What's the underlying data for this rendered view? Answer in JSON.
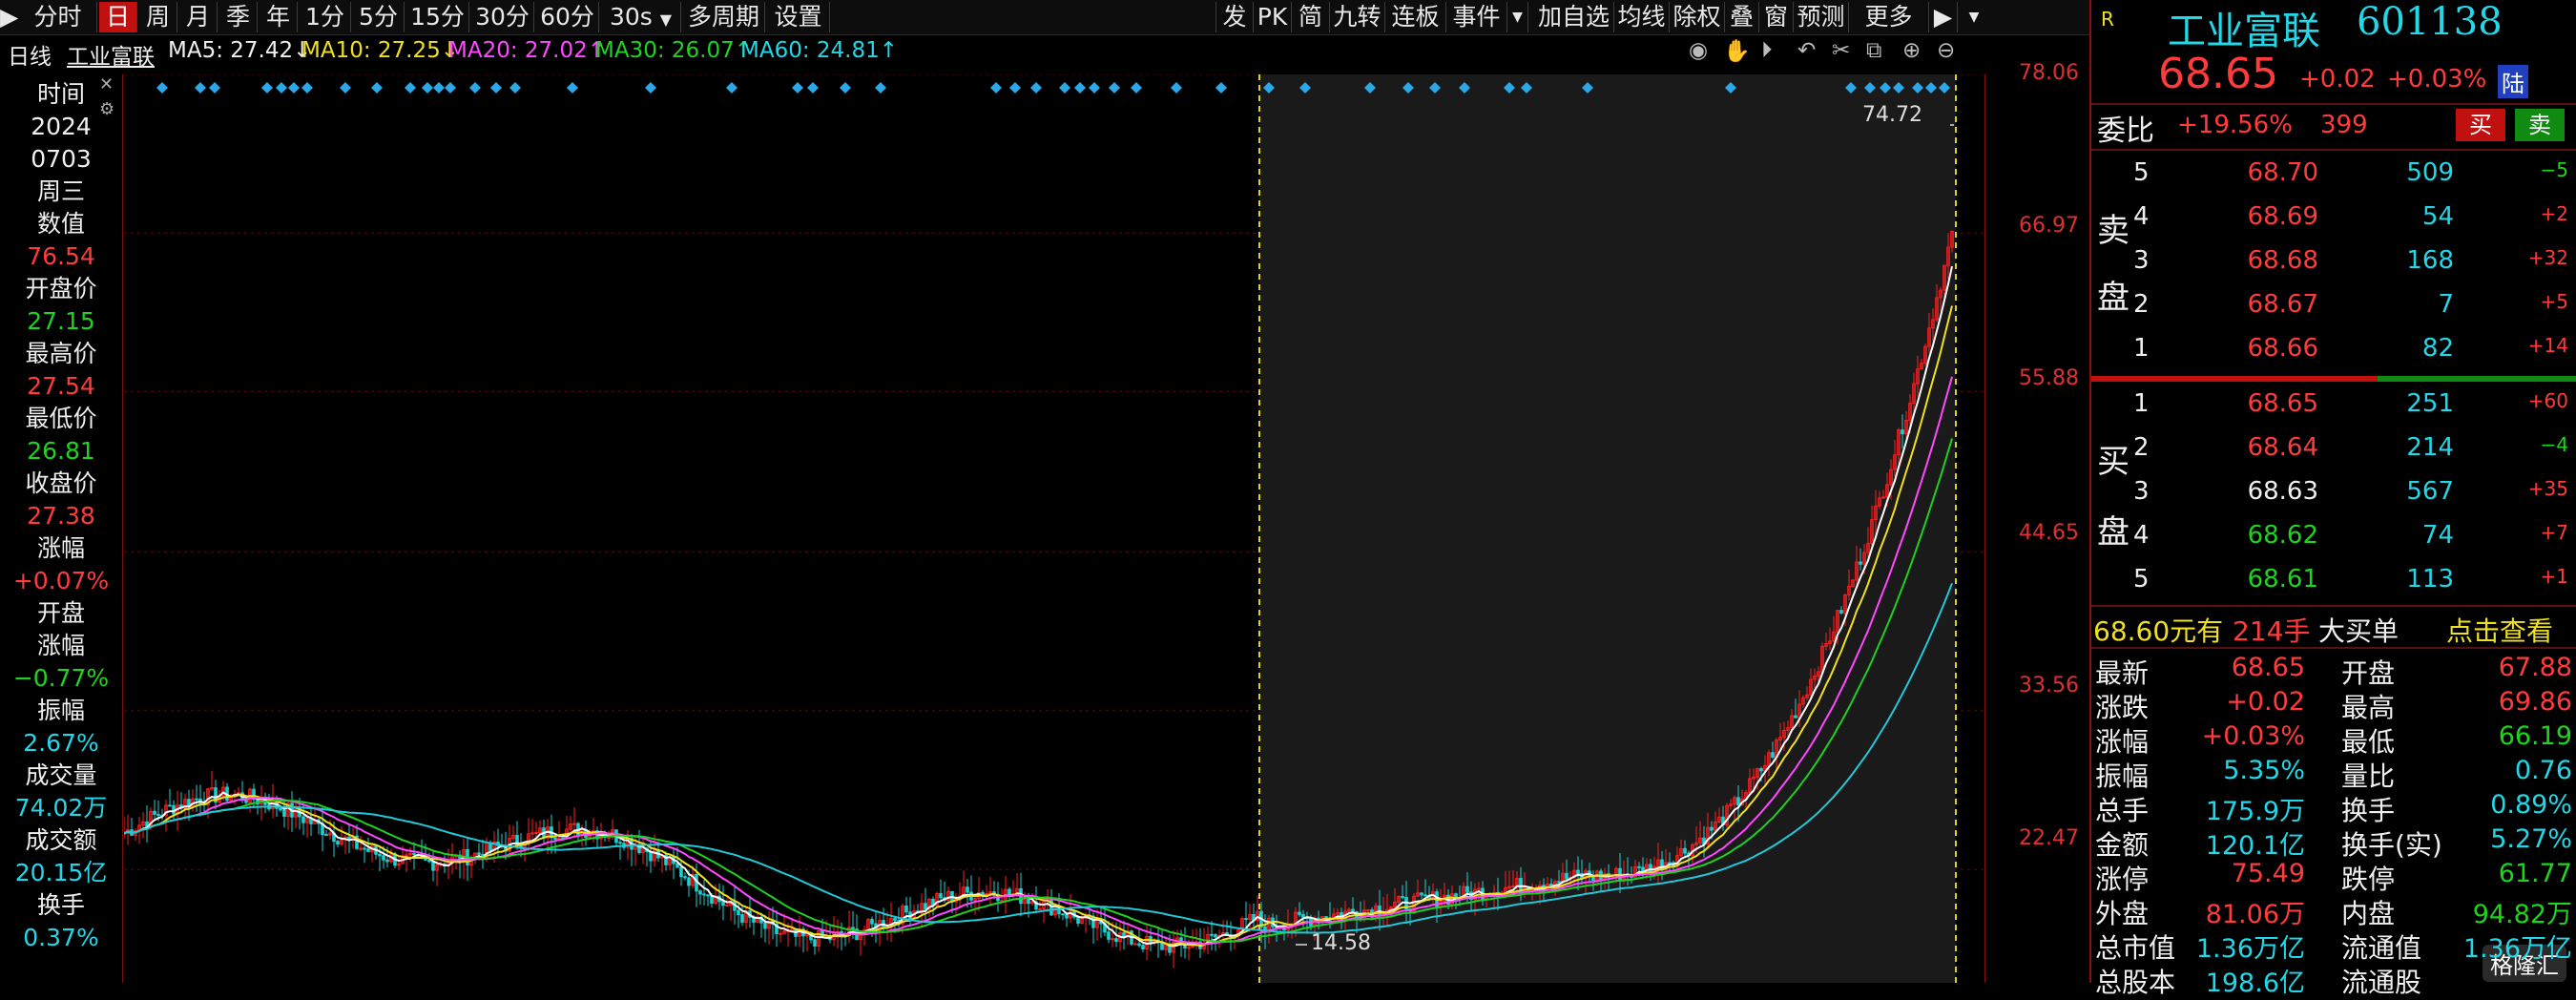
{
  "toolbar": {
    "items": [
      "分时",
      "日",
      "周",
      "月",
      "季",
      "年",
      "1分",
      "5分",
      "15分",
      "30分",
      "60分",
      "30s",
      "多周期",
      "设置"
    ],
    "right_items": [
      "发",
      "PK",
      "简",
      "九转",
      "连板",
      "事件",
      "加自选",
      "均线",
      "除权",
      "叠",
      "窗",
      "预测",
      "更多"
    ]
  },
  "indicators": {
    "period": "日线",
    "name": "工业富联",
    "ma5": "MA5: 27.42↓",
    "ma10": "MA10: 27.25↓",
    "ma20": "MA20: 27.02↑",
    "ma30": "MA30: 26.07↑",
    "ma60": "MA60: 24.81↑"
  },
  "left_info": {
    "time_label": "时间",
    "year": "2024",
    "date": "0703",
    "weekday": "周三",
    "value_label": "数值",
    "value": "76.54",
    "open_label": "开盘价",
    "open": "27.15",
    "high_label": "最高价",
    "high": "27.54",
    "low_label": "最低价",
    "low": "26.81",
    "close_label": "收盘价",
    "close": "27.38",
    "change_label": "涨幅",
    "change": "+0.07%",
    "open_change_label1": "开盘",
    "open_change_label2": "涨幅",
    "open_change": "−0.77%",
    "amplitude_label": "振幅",
    "amplitude": "2.67%",
    "volume_label": "成交量",
    "volume": "74.02万",
    "amount_label": "成交额",
    "amount": "20.15亿",
    "turnover_label": "换手",
    "turnover": "0.37%"
  },
  "axis": {
    "ticks": [
      "78.06",
      "66.97",
      "55.88",
      "44.65",
      "33.56",
      "22.47"
    ]
  },
  "chart_labels": {
    "max_label": "74.72",
    "min_label": "14.58"
  },
  "quote": {
    "r_badge": "R",
    "name": "工业富联",
    "code": "601138",
    "price": "68.65",
    "change": "+0.02",
    "change_pct": "+0.03%",
    "lu_badge": "陆",
    "weibi_label": "委比",
    "weibi": "+19.56%",
    "weicha": "399",
    "buy_btn": "买",
    "sell_btn": "卖",
    "sell_label_1": "卖",
    "sell_label_2": "盘",
    "buy_label_1": "买",
    "buy_label_2": "盘",
    "asks": [
      {
        "lvl": "5",
        "price": "68.70",
        "vol": "509",
        "chg": "−5"
      },
      {
        "lvl": "4",
        "price": "68.69",
        "vol": "54",
        "chg": "+2"
      },
      {
        "lvl": "3",
        "price": "68.68",
        "vol": "168",
        "chg": "+32"
      },
      {
        "lvl": "2",
        "price": "68.67",
        "vol": "7",
        "chg": "+5"
      },
      {
        "lvl": "1",
        "price": "68.66",
        "vol": "82",
        "chg": "+14"
      }
    ],
    "bids": [
      {
        "lvl": "1",
        "price": "68.65",
        "vol": "251",
        "chg": "+60"
      },
      {
        "lvl": "2",
        "price": "68.64",
        "vol": "214",
        "chg": "−4"
      },
      {
        "lvl": "3",
        "price": "68.63",
        "vol": "567",
        "chg": "+35"
      },
      {
        "lvl": "4",
        "price": "68.62",
        "vol": "74",
        "chg": "+7"
      },
      {
        "lvl": "5",
        "price": "68.61",
        "vol": "113",
        "chg": "+1"
      }
    ],
    "bigbuy_price": "68.60元有",
    "bigbuy_vol": "214手",
    "bigbuy_label": "大买单",
    "bigbuy_link": "点击查看",
    "stats_left": [
      {
        "k": "最新",
        "v": "68.65"
      },
      {
        "k": "涨跌",
        "v": "+0.02"
      },
      {
        "k": "涨幅",
        "v": "+0.03%"
      },
      {
        "k": "振幅",
        "v": "5.35%"
      },
      {
        "k": "总手",
        "v": "175.9万"
      },
      {
        "k": "金额",
        "v": "120.1亿"
      },
      {
        "k": "涨停",
        "v": "75.49"
      },
      {
        "k": "外盘",
        "v": "81.06万"
      },
      {
        "k": "总市值",
        "v": "1.36万亿"
      },
      {
        "k": "总股本",
        "v": "198.6亿"
      }
    ],
    "stats_right": [
      {
        "k": "开盘",
        "v": "67.88"
      },
      {
        "k": "最高",
        "v": "69.86"
      },
      {
        "k": "最低",
        "v": "66.19"
      },
      {
        "k": "量比",
        "v": "0.76"
      },
      {
        "k": "换手",
        "v": "0.89%"
      },
      {
        "k": "换手(实)",
        "v": "5.27%"
      },
      {
        "k": "跌停",
        "v": "61.77"
      },
      {
        "k": "内盘",
        "v": "94.82万"
      },
      {
        "k": "流通值",
        "v": "1.36万亿"
      },
      {
        "k": "流通股",
        "v": ""
      }
    ],
    "watermark": "格隆汇"
  }
}
